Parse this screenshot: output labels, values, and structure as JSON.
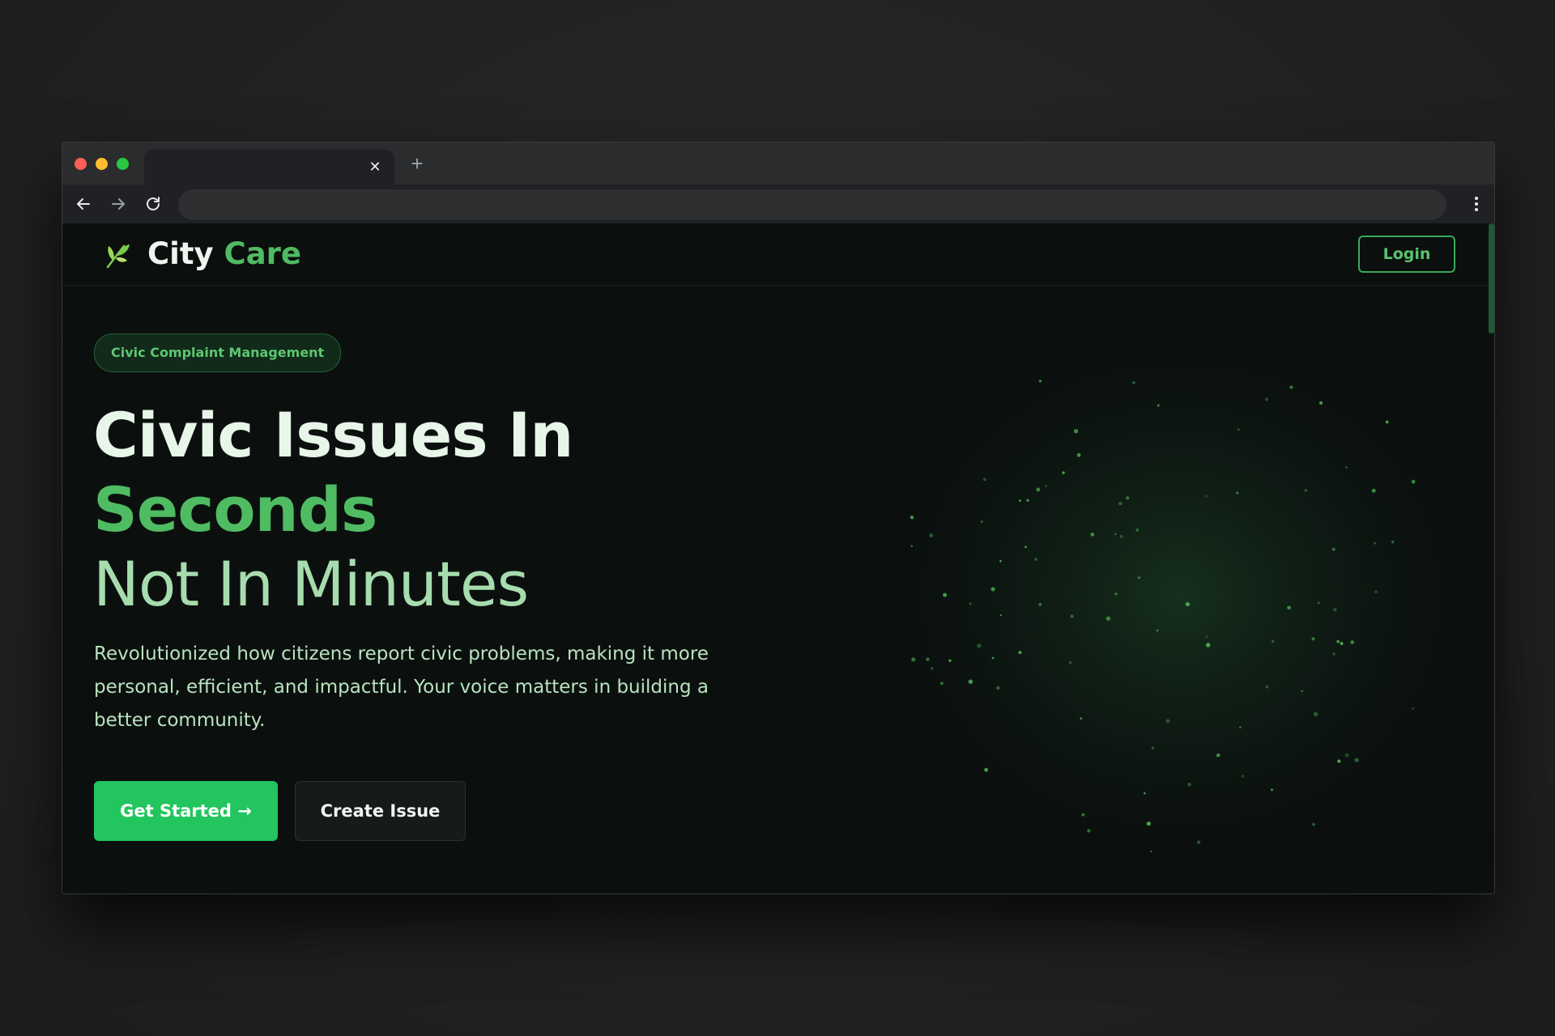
{
  "browser": {
    "tab_close_glyph": "✕",
    "new_tab_glyph": "+",
    "icons": [
      "back-arrow-icon",
      "forward-arrow-icon",
      "reload-icon",
      "kebab-menu-icon",
      "close-icon",
      "plus-icon"
    ]
  },
  "nav": {
    "brand_part1": "City",
    "brand_part2": "Care",
    "logo_icon": "leaf-sprout-icon",
    "login_label": "Login"
  },
  "hero": {
    "badge": "Civic Complaint Management",
    "headline_line1": "Civic Issues In",
    "headline_line2": "Seconds",
    "headline_line3": "Not In Minutes",
    "description": "Revolutionized how citizens report civic problems, making it more personal, efficient, and impactful. Your voice matters in building a better community.",
    "primary_button": "Get Started →",
    "secondary_button": "Create Issue"
  },
  "colors": {
    "accent": "#4fbb62",
    "primary_button": "#22c55e",
    "background": "#0b100e",
    "particle": "#4caf50"
  }
}
